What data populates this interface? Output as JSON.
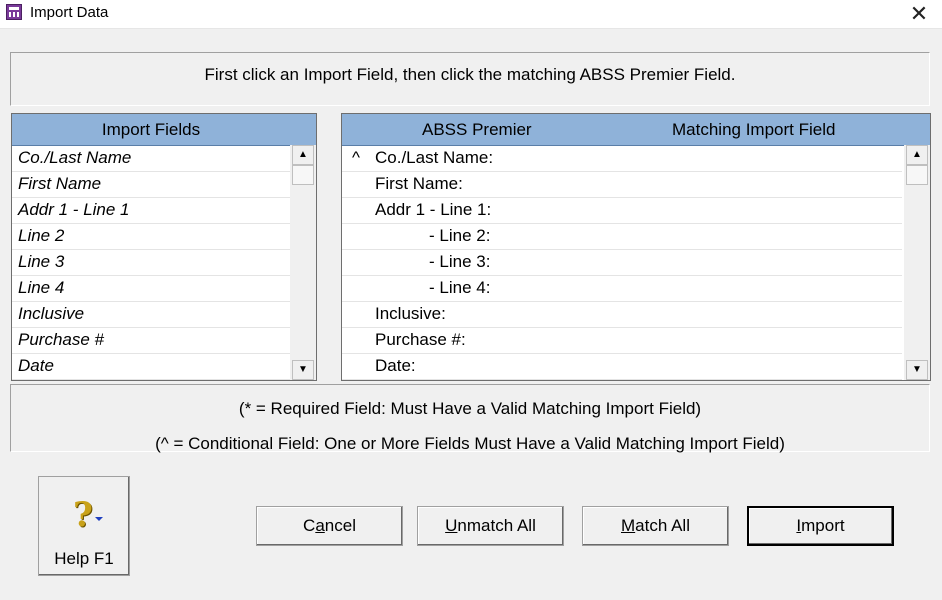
{
  "window": {
    "title": "Import Data"
  },
  "instruction": "First click an Import Field, then click the matching ABSS Premier Field.",
  "import_fields": {
    "header": "Import Fields",
    "items": [
      "Co./Last Name",
      "First Name",
      "Addr 1 - Line 1",
      "Line 2",
      "Line 3",
      "Line 4",
      "Inclusive",
      "Purchase #",
      "Date"
    ]
  },
  "premier_fields": {
    "header_left": "ABSS Premier",
    "header_right": "Matching Import Field",
    "items": [
      {
        "mark": "^",
        "label": "Co./Last Name:",
        "indent": false
      },
      {
        "mark": "",
        "label": "First Name:",
        "indent": false
      },
      {
        "mark": "",
        "label": "Addr 1 - Line 1:",
        "indent": false
      },
      {
        "mark": "",
        "label": "- Line 2:",
        "indent": true
      },
      {
        "mark": "",
        "label": "- Line 3:",
        "indent": true
      },
      {
        "mark": "",
        "label": "- Line 4:",
        "indent": true
      },
      {
        "mark": "",
        "label": "Inclusive:",
        "indent": false
      },
      {
        "mark": "",
        "label": "Purchase #:",
        "indent": false
      },
      {
        "mark": "",
        "label": "Date:",
        "indent": false
      }
    ]
  },
  "notes": {
    "required": "(* = Required Field:  Must Have a Valid Matching Import Field)",
    "conditional": "(^ = Conditional Field:  One or More Fields Must Have a Valid Matching Import Field)"
  },
  "buttons": {
    "help": "Help F1",
    "cancel": {
      "pre": "C",
      "acc": "a",
      "post": "ncel"
    },
    "unmatch_all": {
      "pre": "",
      "acc": "U",
      "post": "nmatch All"
    },
    "match_all": {
      "pre": "",
      "acc": "M",
      "post": "atch All"
    },
    "import": {
      "pre": "",
      "acc": "I",
      "post": "mport"
    }
  },
  "icons": {
    "app": "app-icon",
    "close": "close-icon",
    "help": "help-question-icon",
    "scroll_up": "scroll-up-arrow-icon",
    "scroll_down": "scroll-down-arrow-icon"
  },
  "colors": {
    "list_header": "#8fb2d9",
    "background": "#f0f0f0"
  }
}
